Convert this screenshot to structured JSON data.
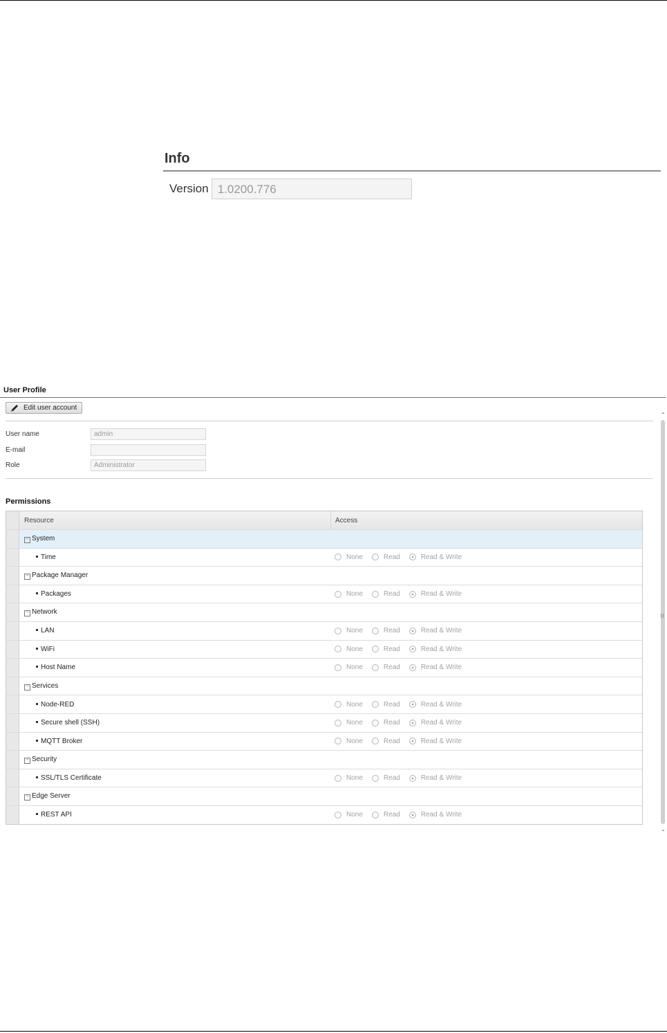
{
  "info": {
    "title": "Info",
    "version_label": "Version",
    "version_value": "1.0200.776"
  },
  "profile": {
    "title": "User Profile",
    "edit_button": "Edit user account",
    "fields": [
      {
        "label": "User name",
        "value": "admin"
      },
      {
        "label": "E-mail",
        "value": ""
      },
      {
        "label": "Role",
        "value": "Administrator"
      }
    ],
    "permissions_title": "Permissions",
    "columns": {
      "resource": "Resource",
      "access": "Access"
    },
    "radio_labels": [
      "None",
      "Read",
      "Read & Write"
    ],
    "rows": [
      {
        "type": "group",
        "label": "System",
        "selected": true
      },
      {
        "type": "item",
        "label": "Time",
        "access": "Read & Write"
      },
      {
        "type": "group",
        "label": "Package Manager"
      },
      {
        "type": "item",
        "label": "Packages",
        "access": "Read & Write"
      },
      {
        "type": "group",
        "label": "Network"
      },
      {
        "type": "item",
        "label": "LAN",
        "access": "Read & Write"
      },
      {
        "type": "item",
        "label": "WiFi",
        "access": "Read & Write"
      },
      {
        "type": "item",
        "label": "Host Name",
        "access": "Read & Write"
      },
      {
        "type": "group",
        "label": "Services"
      },
      {
        "type": "item",
        "label": "Node-RED",
        "access": "Read & Write"
      },
      {
        "type": "item",
        "label": "Secure shell (SSH)",
        "access": "Read & Write"
      },
      {
        "type": "item",
        "label": "MQTT Broker",
        "access": "Read & Write"
      },
      {
        "type": "group",
        "label": "Security"
      },
      {
        "type": "item",
        "label": "SSL/TLS Certificate",
        "access": "Read & Write"
      },
      {
        "type": "group",
        "label": "Edge Server"
      },
      {
        "type": "item",
        "label": "REST API",
        "access": "Read & Write"
      }
    ]
  }
}
